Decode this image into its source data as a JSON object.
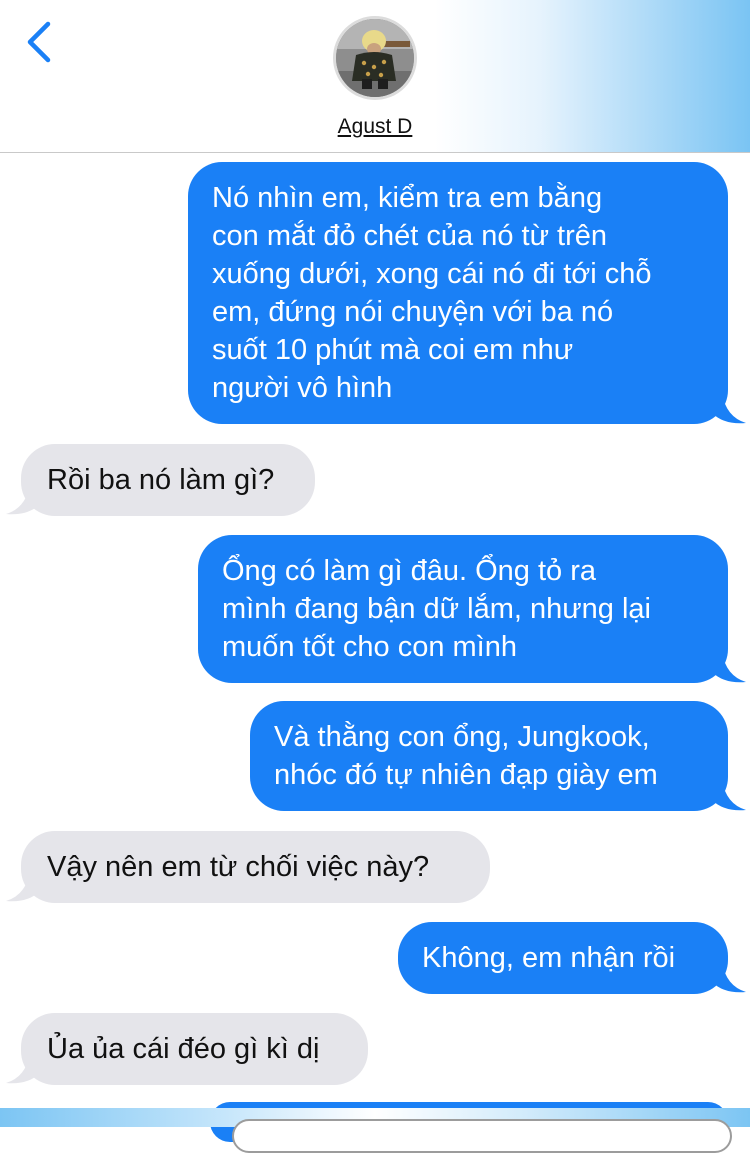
{
  "header": {
    "back_icon": "chevron-left-icon",
    "contact_name": "Agust D",
    "accent_color": "#1a80f6"
  },
  "messages": [
    {
      "direction": "outgoing",
      "text": "Nó nhìn em, kiểm tra em bằng\ncon mắt đỏ chét của nó từ trên\nxuống dưới, xong cái nó đi tới chỗ\nem, đứng nói chuyện với ba nó\nsuốt 10 phút mà coi em như\nngười vô hình"
    },
    {
      "direction": "incoming",
      "text": "Rồi ba nó làm gì?"
    },
    {
      "direction": "outgoing",
      "text": "Ổng có làm gì đâu. Ổng tỏ ra\nmình đang bận dữ lắm, nhưng lại\nmuốn tốt cho con mình"
    },
    {
      "direction": "outgoing",
      "text": "Và thằng con ổng, Jungkook,\nnhóc đó tự nhiên đạp giày em"
    },
    {
      "direction": "incoming",
      "text": "Vậy nên em từ chối việc này?"
    },
    {
      "direction": "outgoing",
      "text": "Không, em nhận rồi"
    },
    {
      "direction": "incoming",
      "text": "Ủa ủa cái đéo gì kì dị"
    }
  ],
  "colors": {
    "outgoing_bubble": "#1a80f6",
    "incoming_bubble": "#e5e5ea"
  }
}
